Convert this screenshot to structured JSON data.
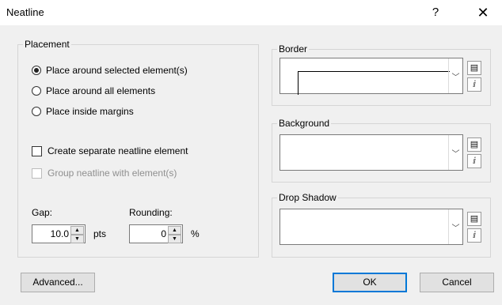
{
  "window": {
    "title": "Neatline",
    "help_label": "?",
    "close_label": "✕"
  },
  "placement": {
    "label": "Placement",
    "options": [
      {
        "label": "Place around selected element(s)",
        "selected": true
      },
      {
        "label": "Place around all elements",
        "selected": false
      },
      {
        "label": "Place inside margins",
        "selected": false
      }
    ],
    "separate_label": "Create separate neatline element",
    "group_label": "Group neatline with element(s)",
    "gap_label": "Gap:",
    "gap_value": "10.0",
    "gap_unit": "pts",
    "rounding_label": "Rounding:",
    "rounding_value": "0",
    "rounding_unit": "%"
  },
  "border": {
    "label": "Border"
  },
  "background": {
    "label": "Background"
  },
  "drop_shadow": {
    "label": "Drop Shadow"
  },
  "buttons": {
    "advanced": "Advanced...",
    "ok": "OK",
    "cancel": "Cancel"
  },
  "icons": {
    "spin_up": "▲",
    "spin_down": "▼",
    "dropdown": "﹀",
    "symbol_selector": "▤",
    "properties": "ⅈ"
  },
  "colors": {
    "accent": "#0078d7",
    "dialog_bg": "#f0f0f0"
  }
}
